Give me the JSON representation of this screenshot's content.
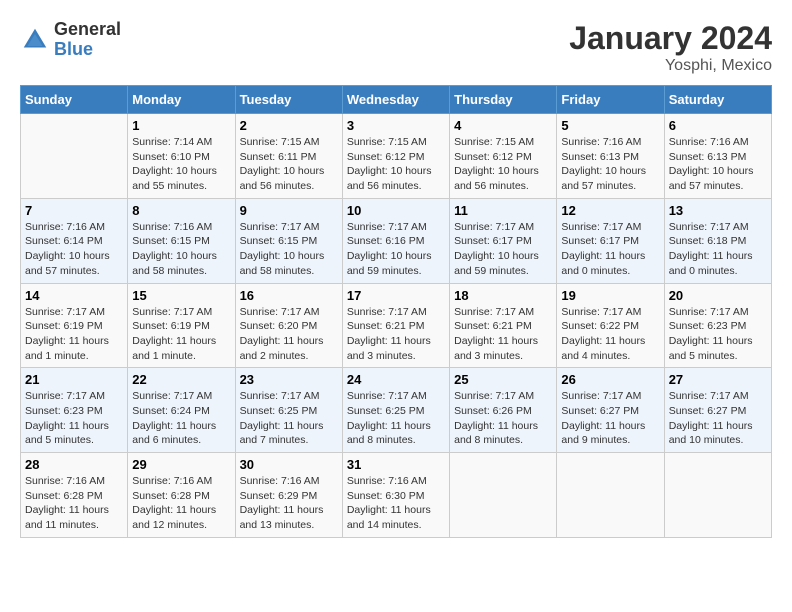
{
  "header": {
    "logo_line1": "General",
    "logo_line2": "Blue",
    "title": "January 2024",
    "subtitle": "Yosphi, Mexico"
  },
  "days_of_week": [
    "Sunday",
    "Monday",
    "Tuesday",
    "Wednesday",
    "Thursday",
    "Friday",
    "Saturday"
  ],
  "weeks": [
    [
      {
        "day": "",
        "info": ""
      },
      {
        "day": "1",
        "info": "Sunrise: 7:14 AM\nSunset: 6:10 PM\nDaylight: 10 hours\nand 55 minutes."
      },
      {
        "day": "2",
        "info": "Sunrise: 7:15 AM\nSunset: 6:11 PM\nDaylight: 10 hours\nand 56 minutes."
      },
      {
        "day": "3",
        "info": "Sunrise: 7:15 AM\nSunset: 6:12 PM\nDaylight: 10 hours\nand 56 minutes."
      },
      {
        "day": "4",
        "info": "Sunrise: 7:15 AM\nSunset: 6:12 PM\nDaylight: 10 hours\nand 56 minutes."
      },
      {
        "day": "5",
        "info": "Sunrise: 7:16 AM\nSunset: 6:13 PM\nDaylight: 10 hours\nand 57 minutes."
      },
      {
        "day": "6",
        "info": "Sunrise: 7:16 AM\nSunset: 6:13 PM\nDaylight: 10 hours\nand 57 minutes."
      }
    ],
    [
      {
        "day": "7",
        "info": "Sunrise: 7:16 AM\nSunset: 6:14 PM\nDaylight: 10 hours\nand 57 minutes."
      },
      {
        "day": "8",
        "info": "Sunrise: 7:16 AM\nSunset: 6:15 PM\nDaylight: 10 hours\nand 58 minutes."
      },
      {
        "day": "9",
        "info": "Sunrise: 7:17 AM\nSunset: 6:15 PM\nDaylight: 10 hours\nand 58 minutes."
      },
      {
        "day": "10",
        "info": "Sunrise: 7:17 AM\nSunset: 6:16 PM\nDaylight: 10 hours\nand 59 minutes."
      },
      {
        "day": "11",
        "info": "Sunrise: 7:17 AM\nSunset: 6:17 PM\nDaylight: 10 hours\nand 59 minutes."
      },
      {
        "day": "12",
        "info": "Sunrise: 7:17 AM\nSunset: 6:17 PM\nDaylight: 11 hours\nand 0 minutes."
      },
      {
        "day": "13",
        "info": "Sunrise: 7:17 AM\nSunset: 6:18 PM\nDaylight: 11 hours\nand 0 minutes."
      }
    ],
    [
      {
        "day": "14",
        "info": "Sunrise: 7:17 AM\nSunset: 6:19 PM\nDaylight: 11 hours\nand 1 minute."
      },
      {
        "day": "15",
        "info": "Sunrise: 7:17 AM\nSunset: 6:19 PM\nDaylight: 11 hours\nand 1 minute."
      },
      {
        "day": "16",
        "info": "Sunrise: 7:17 AM\nSunset: 6:20 PM\nDaylight: 11 hours\nand 2 minutes."
      },
      {
        "day": "17",
        "info": "Sunrise: 7:17 AM\nSunset: 6:21 PM\nDaylight: 11 hours\nand 3 minutes."
      },
      {
        "day": "18",
        "info": "Sunrise: 7:17 AM\nSunset: 6:21 PM\nDaylight: 11 hours\nand 3 minutes."
      },
      {
        "day": "19",
        "info": "Sunrise: 7:17 AM\nSunset: 6:22 PM\nDaylight: 11 hours\nand 4 minutes."
      },
      {
        "day": "20",
        "info": "Sunrise: 7:17 AM\nSunset: 6:23 PM\nDaylight: 11 hours\nand 5 minutes."
      }
    ],
    [
      {
        "day": "21",
        "info": "Sunrise: 7:17 AM\nSunset: 6:23 PM\nDaylight: 11 hours\nand 5 minutes."
      },
      {
        "day": "22",
        "info": "Sunrise: 7:17 AM\nSunset: 6:24 PM\nDaylight: 11 hours\nand 6 minutes."
      },
      {
        "day": "23",
        "info": "Sunrise: 7:17 AM\nSunset: 6:25 PM\nDaylight: 11 hours\nand 7 minutes."
      },
      {
        "day": "24",
        "info": "Sunrise: 7:17 AM\nSunset: 6:25 PM\nDaylight: 11 hours\nand 8 minutes."
      },
      {
        "day": "25",
        "info": "Sunrise: 7:17 AM\nSunset: 6:26 PM\nDaylight: 11 hours\nand 8 minutes."
      },
      {
        "day": "26",
        "info": "Sunrise: 7:17 AM\nSunset: 6:27 PM\nDaylight: 11 hours\nand 9 minutes."
      },
      {
        "day": "27",
        "info": "Sunrise: 7:17 AM\nSunset: 6:27 PM\nDaylight: 11 hours\nand 10 minutes."
      }
    ],
    [
      {
        "day": "28",
        "info": "Sunrise: 7:16 AM\nSunset: 6:28 PM\nDaylight: 11 hours\nand 11 minutes."
      },
      {
        "day": "29",
        "info": "Sunrise: 7:16 AM\nSunset: 6:28 PM\nDaylight: 11 hours\nand 12 minutes."
      },
      {
        "day": "30",
        "info": "Sunrise: 7:16 AM\nSunset: 6:29 PM\nDaylight: 11 hours\nand 13 minutes."
      },
      {
        "day": "31",
        "info": "Sunrise: 7:16 AM\nSunset: 6:30 PM\nDaylight: 11 hours\nand 14 minutes."
      },
      {
        "day": "",
        "info": ""
      },
      {
        "day": "",
        "info": ""
      },
      {
        "day": "",
        "info": ""
      }
    ]
  ]
}
